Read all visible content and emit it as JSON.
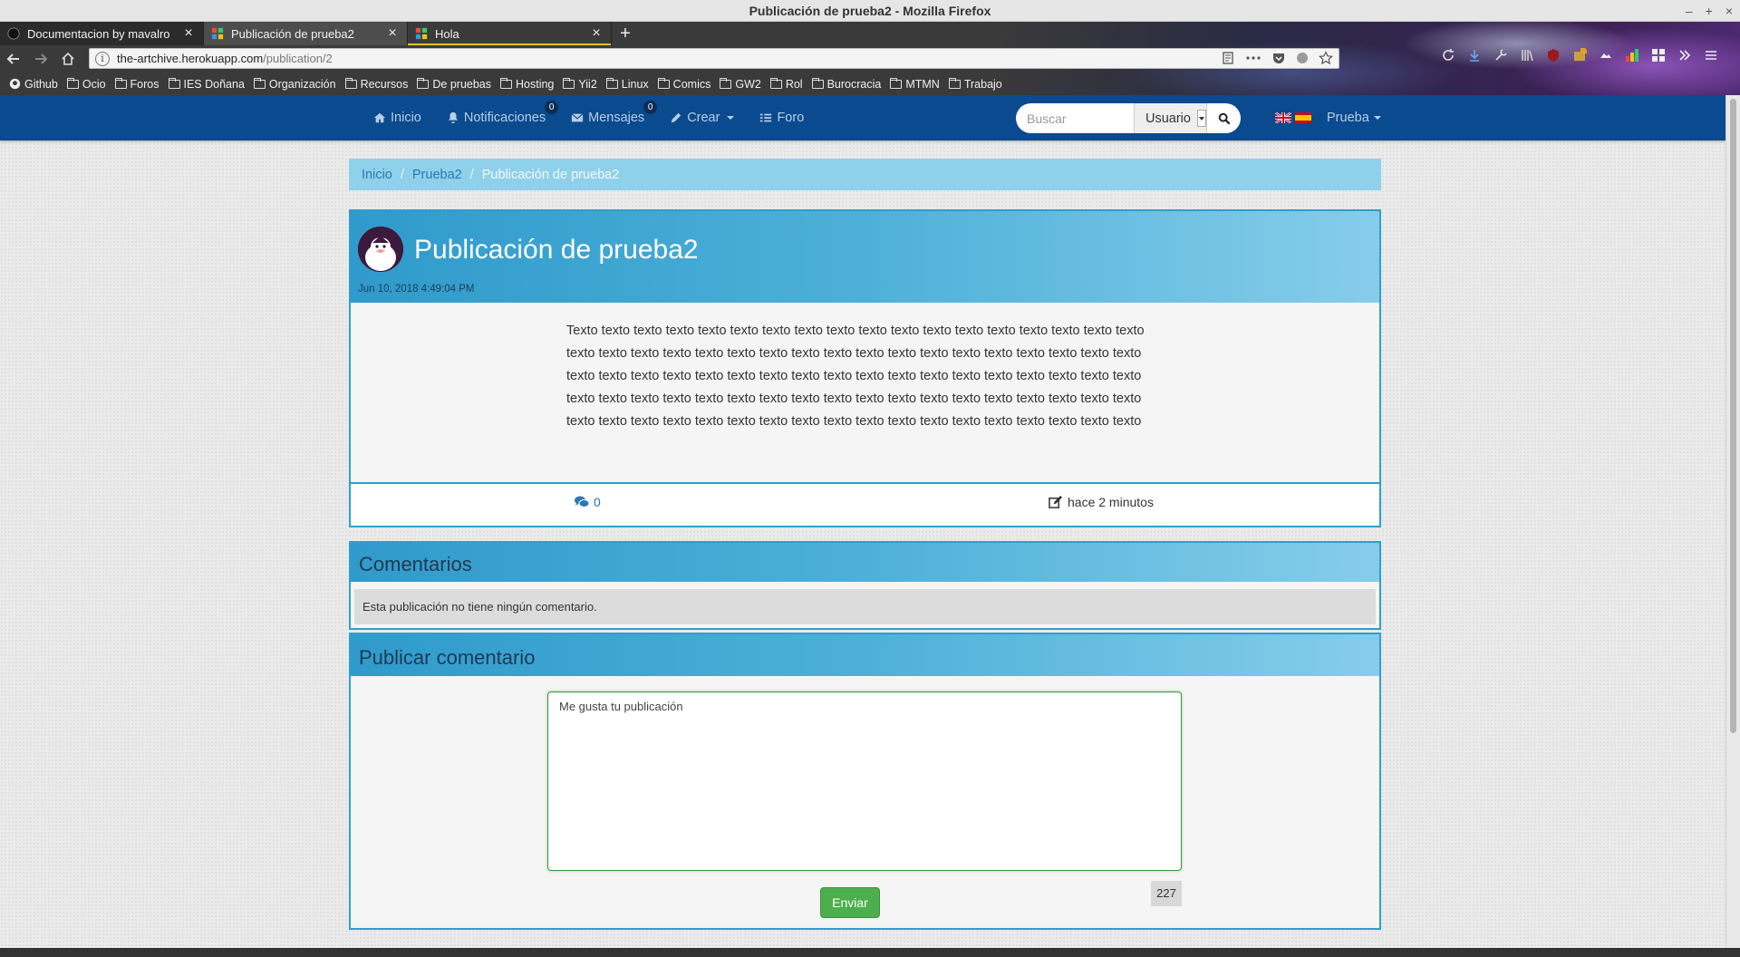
{
  "window": {
    "title": "Publicación de prueba2 - Mozilla Firefox",
    "controls": [
      "–",
      "+",
      "×"
    ]
  },
  "browser": {
    "tabs": [
      {
        "title": "Documentacion by mavalro",
        "close": "×"
      },
      {
        "title": "Publicación de prueba2",
        "close": "×"
      },
      {
        "title": "Hola",
        "close": "×"
      }
    ],
    "new_tab": "+",
    "url_host": "the-artchive.herokuapp.com",
    "url_path": "/publication/2",
    "bookmarks": [
      "Github",
      "Ocio",
      "Foros",
      "IES Doñana",
      "Organización",
      "Recursos",
      "De pruebas",
      "Hosting",
      "Yii2",
      "Linux",
      "Comics",
      "GW2",
      "Rol",
      "Burocracia",
      "MTMN",
      "Trabajo"
    ],
    "colors": {
      "chrome_bg": "#3a3a3a",
      "active_tab_accent": "#e8c21a"
    }
  },
  "nav": {
    "items": [
      {
        "label": "Inicio",
        "icon": "home-icon"
      },
      {
        "label": "Notificaciones",
        "icon": "bell-icon",
        "badge": "0"
      },
      {
        "label": "Mensajes",
        "icon": "envelope-icon",
        "badge": "0"
      },
      {
        "label": "Crear",
        "icon": "pencil-icon",
        "dropdown": true
      },
      {
        "label": "Foro",
        "icon": "list-icon"
      }
    ],
    "search_placeholder": "Buscar",
    "search_type": "Usuario",
    "languages": [
      "en",
      "es"
    ],
    "user": "Prueba",
    "colors": {
      "navbar": "#0a4a8e",
      "link": "#b8cde6"
    }
  },
  "breadcrumb": {
    "items": [
      "Inicio",
      "Prueba2"
    ],
    "separator": "/",
    "current": "Publicación de prueba2"
  },
  "publication": {
    "title": "Publicación de prueba2",
    "date": "Jun 10, 2018 4:49:04 PM",
    "body": "Texto texto texto texto texto texto texto texto texto texto texto texto texto texto texto texto texto texto texto texto texto texto texto texto texto texto texto texto texto texto texto texto texto texto texto texto texto texto texto texto texto texto texto texto texto texto texto texto texto texto texto texto texto texto texto texto texto texto texto texto texto texto texto texto texto texto texto texto texto texto texto texto texto texto texto texto texto texto texto texto texto texto texto texto texto texto texto texto texto texto",
    "comment_count": "0",
    "edited": "hace 2 minutos",
    "colors": {
      "accent": "#2f9fcd"
    }
  },
  "comments": {
    "title": "Comentarios",
    "empty": "Esta publicación no tiene ningún comentario."
  },
  "publish": {
    "title": "Publicar comentario",
    "text": "Me gusta tu publicación",
    "remaining": "227",
    "submit": "Enviar",
    "colors": {
      "submit": "#4cae4c"
    }
  }
}
